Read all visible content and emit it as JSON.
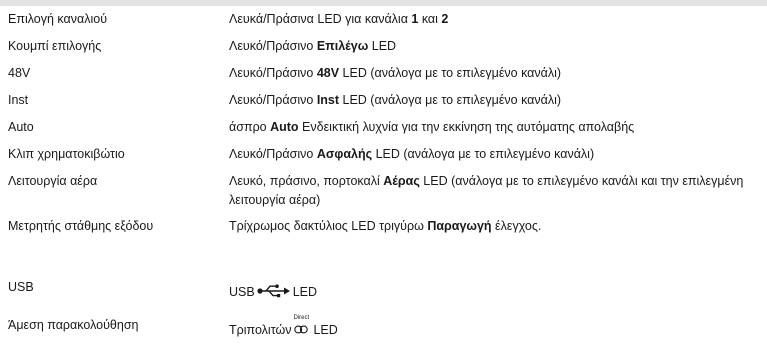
{
  "rows": [
    {
      "label": "Επιλογή καναλιού",
      "desc": [
        {
          "t": "Λευκά/Πράσινα LED για κανάλια "
        },
        {
          "t": "1",
          "b": true
        },
        {
          "t": " και "
        },
        {
          "t": "2",
          "b": true
        }
      ]
    },
    {
      "label": "Κουμπί επιλογής",
      "desc": [
        {
          "t": "Λευκό/Πράσινο "
        },
        {
          "t": "Επιλέγω",
          "b": true
        },
        {
          "t": " LED"
        }
      ]
    },
    {
      "label": "48V",
      "desc": [
        {
          "t": "Λευκό/Πράσινο "
        },
        {
          "t": "48V",
          "b": true
        },
        {
          "t": " LED (ανάλογα με το επιλεγμένο κανάλι)"
        }
      ]
    },
    {
      "label": "Inst",
      "desc": [
        {
          "t": "Λευκό/Πράσινο "
        },
        {
          "t": "Inst",
          "b": true
        },
        {
          "t": " LED (ανάλογα με το επιλεγμένο κανάλι)"
        }
      ]
    },
    {
      "label": "Auto",
      "desc": [
        {
          "t": "άσπρο "
        },
        {
          "t": "Auto",
          "b": true
        },
        {
          "t": " Ενδεικτική λυχνία για την εκκίνηση της αυτόματης απολαβής"
        }
      ]
    },
    {
      "label": "Κλιπ χρηματοκιβώτιο",
      "desc": [
        {
          "t": "Λευκό/Πράσινο "
        },
        {
          "t": "Ασφαλής",
          "b": true
        },
        {
          "t": " LED (ανάλογα με το επιλεγμένο κανάλι)"
        }
      ]
    },
    {
      "label": "Λειτουργία αέρα",
      "desc": [
        {
          "t": "Λευκό, πράσινο, πορτοκαλί "
        },
        {
          "t": "Αέρας",
          "b": true
        },
        {
          "t": " LED (ανάλογα με το επιλεγμένο κανάλι και την επιλεγμένη λειτουργία αέρα)"
        }
      ]
    },
    {
      "label": "Μετρητής στάθμης εξόδου",
      "desc": [
        {
          "t": "Τρίχρωμος δακτύλιος LED τριγύρω "
        },
        {
          "t": "Παραγωγή",
          "b": true
        },
        {
          "t": " έλεγχος."
        }
      ]
    },
    {
      "label": "USB",
      "desc": [
        {
          "t": "USB"
        },
        {
          "icon": "usb-icon"
        },
        {
          "t": "LED"
        }
      ]
    },
    {
      "label": "Άμεση παρακολούθηση",
      "desc": [
        {
          "t": "Τριπολιτών"
        },
        {
          "icon": "direct-monitor-icon",
          "caption": "Direct"
        },
        {
          "t": "LED"
        }
      ]
    }
  ]
}
